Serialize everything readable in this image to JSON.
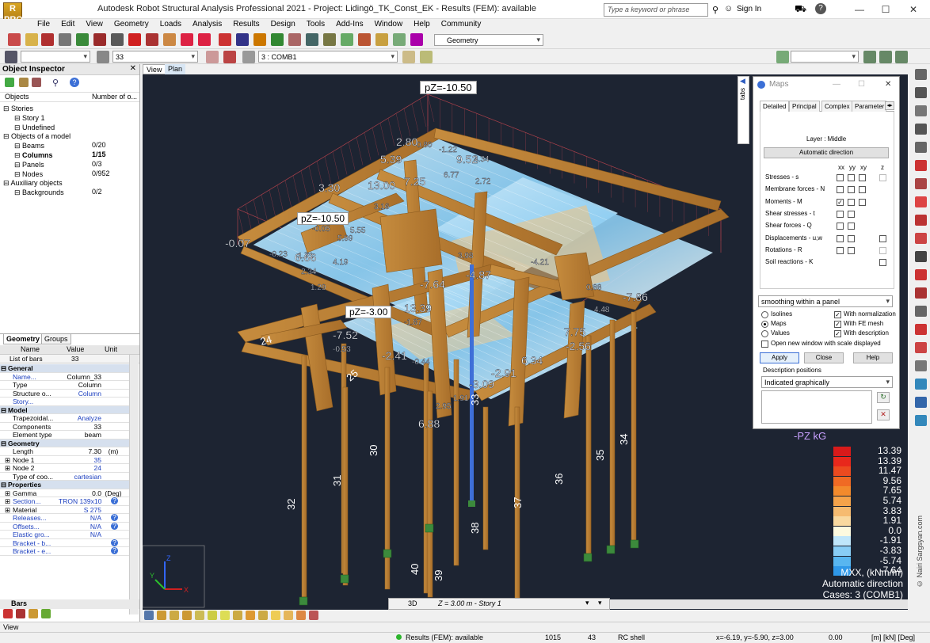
{
  "window": {
    "title": "Autodesk Robot Structural Analysis Professional 2021 - Project: Lidingö_TK_Const_EK - Results (FEM): available",
    "search_placeholder": "Type a keyword or phrase",
    "sign_in": "Sign In",
    "logo": "R PRO"
  },
  "menu": [
    "File",
    "Edit",
    "View",
    "Geometry",
    "Loads",
    "Analysis",
    "Results",
    "Design",
    "Tools",
    "Add-Ins",
    "Window",
    "Help",
    "Community"
  ],
  "toolbar": {
    "layout_combo": "Geometry",
    "bar_number": "33",
    "load_case": "3 : COMB1"
  },
  "inspector": {
    "title": "Object Inspector",
    "col_objects": "Objects",
    "col_number": "Number of o...",
    "tree": [
      {
        "label": "Stories",
        "count": "",
        "indent": 1,
        "bold": false
      },
      {
        "label": "Story 1",
        "count": "",
        "indent": 2,
        "bold": false
      },
      {
        "label": "Undefined",
        "count": "",
        "indent": 2,
        "bold": false
      },
      {
        "label": "Objects of a model",
        "count": "",
        "indent": 1,
        "bold": false
      },
      {
        "label": "Beams",
        "count": "0/20",
        "indent": 2,
        "bold": false
      },
      {
        "label": "Columns",
        "count": "1/15",
        "indent": 2,
        "bold": true
      },
      {
        "label": "Panels",
        "count": "0/3",
        "indent": 2,
        "bold": false
      },
      {
        "label": "Nodes",
        "count": "0/952",
        "indent": 2,
        "bold": false
      },
      {
        "label": "Auxiliary objects",
        "count": "",
        "indent": 1,
        "bold": false
      },
      {
        "label": "Backgrounds",
        "count": "0/2",
        "indent": 2,
        "bold": false
      }
    ],
    "tabs": [
      "Geometry",
      "Groups"
    ],
    "prop_head": {
      "name": "Name",
      "value": "Value",
      "unit": "Unit"
    },
    "list_of_bars": {
      "name": "List of bars",
      "value": "33"
    },
    "props": [
      {
        "sec": true,
        "name": "General"
      },
      {
        "name": "Name...",
        "value": "Column_33",
        "unit": "",
        "link": true
      },
      {
        "name": "Type",
        "value": "Column",
        "unit": ""
      },
      {
        "name": "Structure o...",
        "value": "Column",
        "unit": "",
        "vlink": true
      },
      {
        "name": "Story...",
        "value": "",
        "unit": "",
        "link": true
      },
      {
        "sec": true,
        "name": "Model"
      },
      {
        "name": "Trapezoidal...",
        "value": "Analyze",
        "unit": "",
        "vlink": true
      },
      {
        "name": "Components",
        "value": "33",
        "unit": ""
      },
      {
        "name": "Element type",
        "value": "beam",
        "unit": ""
      },
      {
        "sec": true,
        "name": "Geometry"
      },
      {
        "name": "Length",
        "value": "7.30",
        "unit": "(m)"
      },
      {
        "name": "Node 1",
        "value": "35",
        "unit": "",
        "vlink": true,
        "plus": true
      },
      {
        "name": "Node 2",
        "value": "24",
        "unit": "",
        "vlink": true,
        "plus": true
      },
      {
        "name": "Type of coo...",
        "value": "cartesian",
        "unit": "",
        "vlink": true
      },
      {
        "sec": true,
        "name": "Properties"
      },
      {
        "name": "Gamma",
        "value": "0.0",
        "unit": "(Deg)",
        "plus": true
      },
      {
        "name": "Section...",
        "value": "TRON 139x10",
        "unit": "?",
        "link": true,
        "vlink": true,
        "plus": true
      },
      {
        "name": "Material",
        "value": "S 275",
        "unit": "",
        "vlink": true,
        "plus": true
      },
      {
        "name": "Releases...",
        "value": "N/A",
        "unit": "?",
        "link": true,
        "vlink": true
      },
      {
        "name": "Offsets...",
        "value": "N/A",
        "unit": "?",
        "link": true,
        "vlink": true
      },
      {
        "name": "Elastic gro...",
        "value": "N/A",
        "unit": "",
        "link": true,
        "vlink": true
      },
      {
        "name": "Bracket - b...",
        "value": "",
        "unit": "?",
        "link": true
      },
      {
        "name": "Bracket - e...",
        "value": "",
        "unit": "?",
        "link": true
      }
    ],
    "bars_tab": "Bars"
  },
  "view": {
    "tabs": [
      "View",
      "Plan"
    ],
    "pz_labels": [
      "pZ=-10.50",
      "pZ=-10.50",
      "pZ=-3.00"
    ],
    "bottom_3d": "3D",
    "bottom_story": "Z = 3.00 m - Story 1",
    "tabs_label": "tabs",
    "bar_numbers": [
      "24",
      "25",
      "30",
      "31",
      "32",
      "33",
      "34",
      "35",
      "36",
      "37",
      "38",
      "39",
      "40"
    ],
    "values": [
      "-0.07",
      "-0.23",
      "1.71",
      "6.66",
      "2.34",
      "1.29",
      "-0.05",
      "5.99",
      "5.55",
      "4.19",
      "3.16",
      "7.25",
      "13.00",
      "5.39",
      "3.30",
      "9.52",
      "2.80",
      "0.80",
      "-1.22",
      "6.77",
      "4.34",
      "2.72",
      "13.39",
      "-7.64",
      "-4.87",
      "-4.21",
      "-2.56",
      "6.34",
      "-2.91",
      "-3.09",
      "7.75",
      "-7.86",
      "4.48",
      "0.88",
      "-7.52",
      "-2.41",
      "-0.44",
      "-0.53",
      "-1.87",
      "1.91",
      "2.95",
      "6.88",
      "3.98"
    ],
    "legend_unit": "-PZ kG",
    "legend_values": [
      "13.39",
      "13.39",
      "11.47",
      "9.56",
      "7.65",
      "5.74",
      "3.83",
      "1.91",
      "0.0",
      "-1.91",
      "-3.83",
      "-5.74",
      "-7.64"
    ],
    "legend_colors": [
      "#d81a1a",
      "#e8281c",
      "#ec4a1f",
      "#f06a24",
      "#f38a2c",
      "#f5a34a",
      "#f6bb70",
      "#f9d9a0",
      "#fdfadf",
      "#bfe6fa",
      "#88cdf5",
      "#58b6f0",
      "#2f98e8"
    ],
    "legend_caption": [
      "MXX, (kNm/m)",
      "Automatic direction",
      "Cases: 3 (COMB1)"
    ],
    "watermark": "© Nairi Sargsyan.com"
  },
  "maps": {
    "title": "Maps",
    "tabs": [
      "Detailed",
      "Principal",
      "Complex",
      "Parameter"
    ],
    "layer": "Layer : Middle",
    "auto_dir": "Automatic direction",
    "cols": [
      "xx",
      "yy",
      "xy",
      "z"
    ],
    "rows": [
      {
        "label": "Stresses - s",
        "checks": [
          false,
          false,
          false,
          false
        ],
        "z_dis": true
      },
      {
        "label": "Membrane forces - N",
        "checks": [
          false,
          false,
          false,
          null
        ]
      },
      {
        "label": "Moments - M",
        "checks": [
          true,
          false,
          false,
          null
        ]
      },
      {
        "label": "Shear stresses - t",
        "checks": [
          false,
          false,
          null,
          null
        ]
      },
      {
        "label": "Shear forces - Q",
        "checks": [
          false,
          false,
          null,
          null
        ]
      },
      {
        "label": "Displacements - u,w",
        "checks": [
          false,
          false,
          null,
          false
        ]
      },
      {
        "label": "Rotations - R",
        "checks": [
          false,
          false,
          null,
          false
        ],
        "z_dis": true
      },
      {
        "label": "Soil reactions - K",
        "checks": [
          null,
          null,
          null,
          false
        ]
      }
    ],
    "smoothing": "smoothing within a panel",
    "isolines": "Isolines",
    "maps_opt": "Maps",
    "values_opt": "Values",
    "normalization": "With normalization",
    "fe_mesh": "With FE mesh",
    "description": "With description",
    "new_window": "Open new window with scale displayed",
    "apply": "Apply",
    "close": "Close",
    "help": "Help",
    "desc_positions": "Description positions",
    "indicated": "Indicated graphically"
  },
  "status": {
    "view": "View",
    "results": "Results (FEM): available",
    "n1": "1015",
    "n2": "43",
    "elem": "RC shell",
    "coords": "x=-6.19, y=-5.90, z=3.00",
    "angle": "0.00",
    "units": "[m] [kN] [Deg]"
  }
}
